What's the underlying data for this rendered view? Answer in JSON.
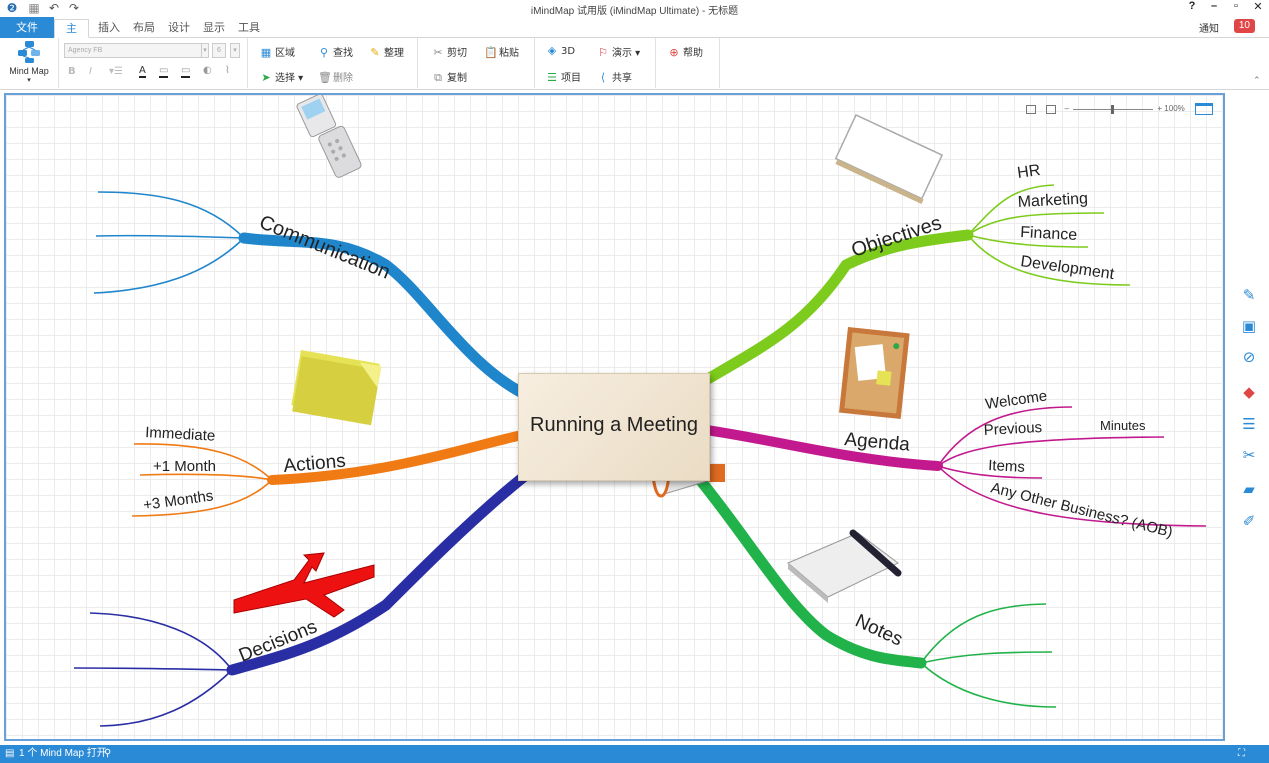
{
  "window": {
    "title": "iMindMap 试用版 (iMindMap Ultimate) - 无标题",
    "help": "?",
    "minimize": "–",
    "restore": "▫",
    "close": "✕"
  },
  "tabs": {
    "file": "文件",
    "home": "主页",
    "insert": "插入",
    "layout": "布局",
    "design": "设计",
    "view": "显示",
    "tools": "工具"
  },
  "notify": {
    "label": "通知",
    "count": "10"
  },
  "ribbon": {
    "mindmap_label": "Mind Map",
    "font_name": "Agency FB",
    "font_size": "6",
    "area": "区域",
    "find": "查找",
    "tidy": "整理",
    "cut": "剪切",
    "paste": "粘贴",
    "threeD": "3D",
    "present": "演示",
    "help": "帮助",
    "select": "选择",
    "delete": "删除",
    "copy": "复制",
    "project": "项目",
    "share": "共享"
  },
  "zoom": {
    "level": "100%"
  },
  "map": {
    "central": "Running a Meeting",
    "branches": {
      "communication": "Communication",
      "objectives": "Objectives",
      "actions": "Actions",
      "agenda": "Agenda",
      "decisions": "Decisions",
      "notes": "Notes"
    },
    "objectives_children": [
      "HR",
      "Marketing",
      "Finance",
      "Development"
    ],
    "actions_children": [
      "Immediate",
      "+1 Month",
      "+3 Months"
    ],
    "agenda_children": [
      "Welcome",
      "Previous",
      "Minutes",
      "Items",
      "Any Other Business? (AOB)"
    ]
  },
  "colors": {
    "communication": "#1f86cc",
    "objectives": "#7dcb1c",
    "actions": "#f07a14",
    "agenda": "#c21a8e",
    "decisions": "#2a2ea4",
    "notes": "#22b24a",
    "accent": "#2b8ad6"
  },
  "status": {
    "text": "1 个 Mind Map 打开"
  }
}
